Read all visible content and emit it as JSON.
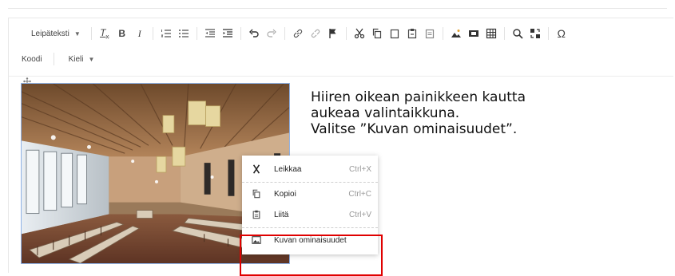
{
  "toolbar": {
    "format_dropdown": "Leipäteksti",
    "code_label": "Koodi",
    "language_dropdown": "Kieli",
    "omega": "Ω"
  },
  "instruction": {
    "line1": "Hiiren oikean painikkeen kautta",
    "line2": "aukeaa valintaikkuna.",
    "line3": "Valitse ”Kuvan ominaisuudet”."
  },
  "context_menu": {
    "items": [
      {
        "label": "Leikkaa",
        "shortcut": "Ctrl+X",
        "icon": "scissors-icon"
      },
      {
        "label": "Kopioi",
        "shortcut": "Ctrl+C",
        "icon": "copy-icon"
      },
      {
        "label": "Liitä",
        "shortcut": "Ctrl+V",
        "icon": "paste-icon"
      },
      {
        "label": "Kuvan ominaisuudet",
        "shortcut": "",
        "icon": "image-icon"
      }
    ]
  },
  "colors": {
    "highlight": "#e00000",
    "image_border": "#8fb2e6"
  }
}
